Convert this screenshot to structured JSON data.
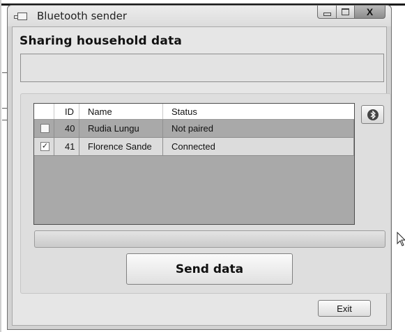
{
  "window": {
    "title": "Bluetooth sender"
  },
  "heading": "Sharing household data",
  "info_box_text": "",
  "table": {
    "columns": [
      "",
      "ID",
      "Name",
      "Status"
    ],
    "rows": [
      {
        "checked": false,
        "id": "40",
        "name": "Rudia Lungu",
        "status": "Not paired"
      },
      {
        "checked": true,
        "id": "41",
        "name": "Florence Sande",
        "status": "Connected"
      }
    ]
  },
  "progress": {
    "percent": 0
  },
  "buttons": {
    "send": "Send data",
    "exit": "Exit"
  },
  "icons": {
    "bluetooth": "bluetooth-icon",
    "checkbox_mark": "✓",
    "close_glyph": "X"
  }
}
